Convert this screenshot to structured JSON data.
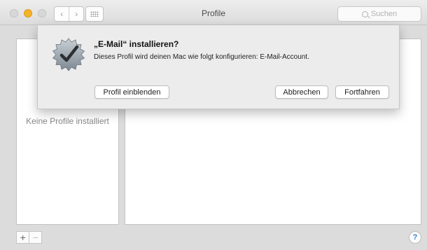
{
  "window": {
    "title": "Profile",
    "search_placeholder": "Suchen",
    "back_glyph": "‹",
    "forward_glyph": "›"
  },
  "left_pane": {
    "empty_text": "Keine Profile installiert"
  },
  "bottom_bar": {
    "add_label": "+",
    "remove_label": "−",
    "help_label": "?"
  },
  "dialog": {
    "title": "„E-Mail“ installieren?",
    "message": "Dieses Profil wird deinen Mac wie folgt konfigurieren: E-Mail-Account.",
    "show_profile_label": "Profil einblenden",
    "cancel_label": "Abbrechen",
    "continue_label": "Fortfahren",
    "icon": "badge-checkmark-icon"
  },
  "colors": {
    "minimize": "#f4b22a",
    "help_accent": "#3a7bd5"
  }
}
